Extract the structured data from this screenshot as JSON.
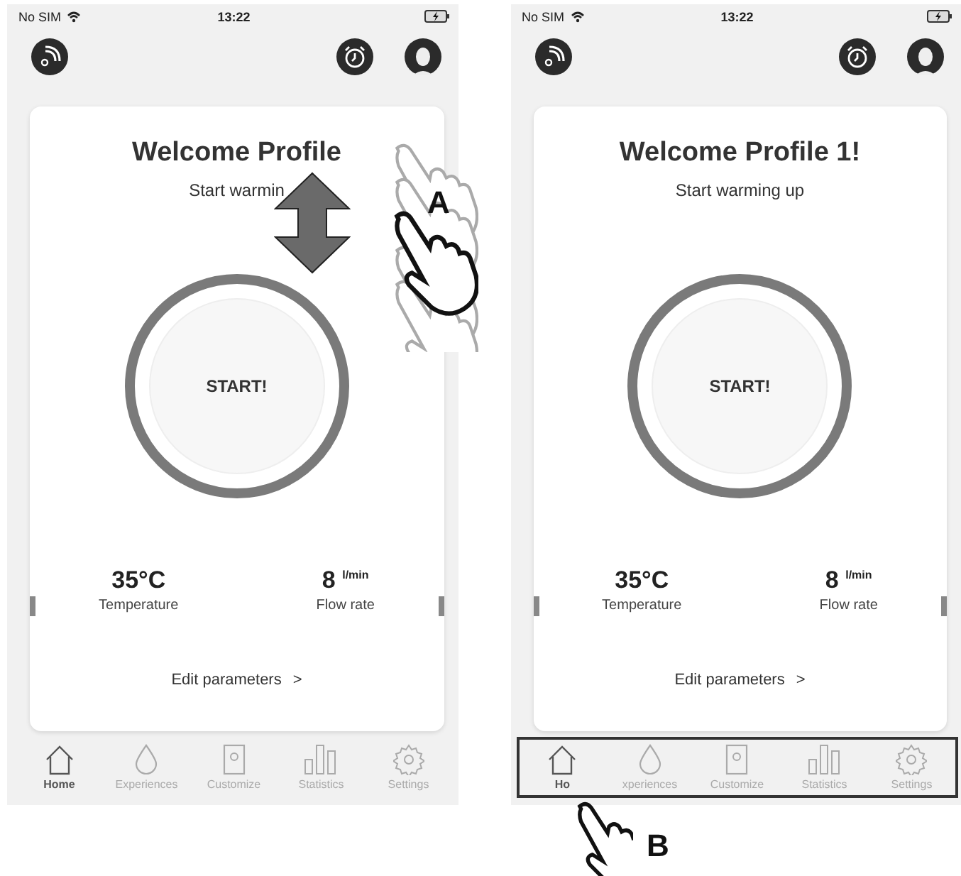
{
  "screens": [
    {
      "status": {
        "carrier": "No SIM",
        "time": "13:22"
      },
      "title": "Welcome Profile",
      "subtitle": "Start warmin",
      "start": "START!",
      "readings": [
        {
          "value": "35°C",
          "label": "Temperature"
        },
        {
          "value": "8 $^{l/min}$",
          "label": "Flow rate"
        }
      ],
      "edit": "Edit parameters",
      "chevron": ">",
      "tabbar_highlighted": false,
      "tabs": [
        {
          "kind": "home",
          "label": "Home",
          "selected": true
        },
        {
          "kind": "drop",
          "label": "Experiences",
          "selected": false
        },
        {
          "kind": "customize",
          "label": "Customize",
          "selected": false
        },
        {
          "kind": "stats",
          "label": "Statistics",
          "selected": false
        },
        {
          "kind": "settings",
          "label": "Settings",
          "selected": false
        }
      ],
      "gesture": {
        "kind": "swipe",
        "label": "A"
      }
    },
    {
      "status": {
        "carrier": "No SIM",
        "time": "13:22"
      },
      "title": "Welcome Profile 1!",
      "subtitle": "Start warming up",
      "start": "START!",
      "readings": [
        {
          "value": "35°C",
          "label": "Temperature"
        },
        {
          "value": "8 $^{l/min}$",
          "label": "Flow rate"
        }
      ],
      "edit": "Edit parameters",
      "chevron": ">",
      "tabbar_highlighted": true,
      "tabs": [
        {
          "kind": "home",
          "label": "Ho",
          "selected": true
        },
        {
          "kind": "drop",
          "label": "xperiences",
          "selected": false
        },
        {
          "kind": "customize",
          "label": "Customize",
          "selected": false
        },
        {
          "kind": "stats",
          "label": "Statistics",
          "selected": false
        },
        {
          "kind": "settings",
          "label": "Settings",
          "selected": false
        }
      ],
      "gesture": {
        "kind": "tap",
        "label": "B"
      }
    }
  ]
}
